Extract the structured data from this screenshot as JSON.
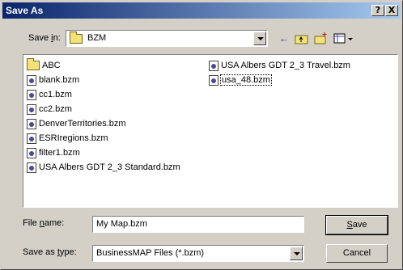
{
  "window": {
    "title": "Save As",
    "help_label": "?",
    "close_label": "X"
  },
  "save_in": {
    "label_pre": "Save ",
    "label_key": "i",
    "label_post": "n:",
    "value": "BZM",
    "icons": [
      "back-arrow-icon",
      "up-folder-icon",
      "new-folder-icon",
      "view-menu-icon"
    ]
  },
  "files": {
    "column1": [
      {
        "name": "ABC",
        "type": "folder"
      },
      {
        "name": "blank.bzm",
        "type": "file"
      },
      {
        "name": "cc1.bzm",
        "type": "file"
      },
      {
        "name": "cc2.bzm",
        "type": "file"
      },
      {
        "name": "DenverTerritories.bzm",
        "type": "file"
      },
      {
        "name": "ESRIregions.bzm",
        "type": "file"
      },
      {
        "name": "filter1.bzm",
        "type": "file"
      },
      {
        "name": "USA Albers GDT 2_3 Standard.bzm",
        "type": "file"
      }
    ],
    "column2": [
      {
        "name": "USA Albers GDT 2_3 Travel.bzm",
        "type": "file"
      },
      {
        "name": "usa_48.bzm",
        "type": "file"
      }
    ]
  },
  "file_name": {
    "label_pre": "File ",
    "label_key": "n",
    "label_post": "ame:",
    "value": "My Map.bzm"
  },
  "save_as_type": {
    "label_pre": "Save as ",
    "label_key": "t",
    "label_post": "ype:",
    "value": "BusinessMAP Files (*.bzm)"
  },
  "buttons": {
    "save_key": "S",
    "save_rest": "ave",
    "cancel": "Cancel"
  }
}
